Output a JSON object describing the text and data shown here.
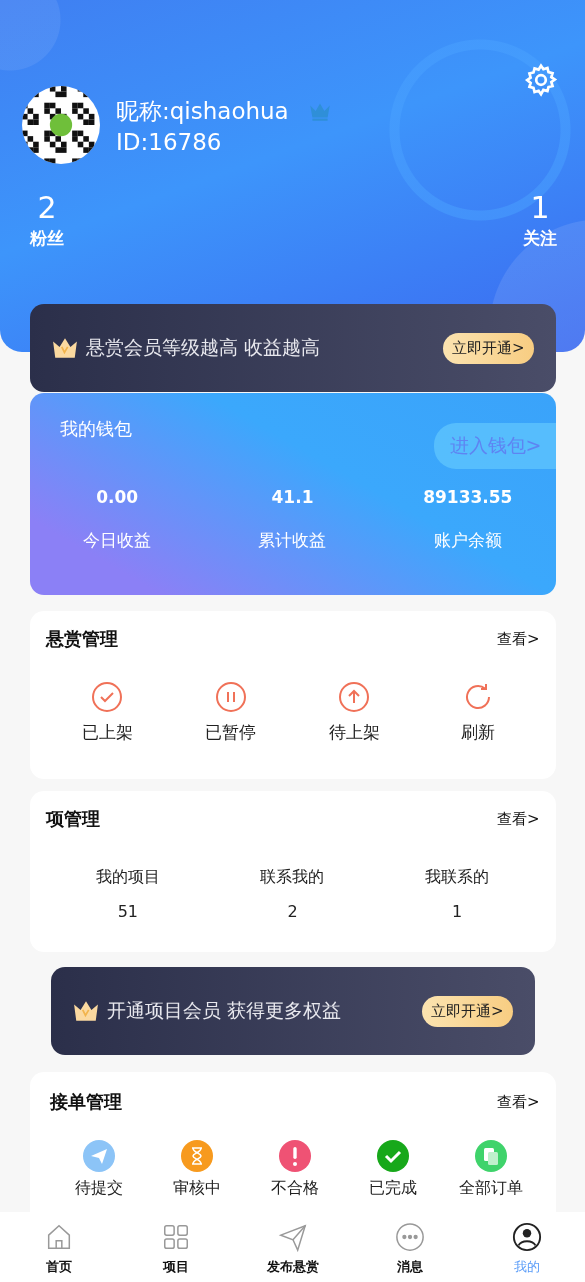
{
  "profile": {
    "nickname": "昵称:qishaohua",
    "id": "ID:16786",
    "stats": [
      {
        "value": "2",
        "label": "粉丝"
      },
      {
        "value": "1",
        "label": "关注"
      }
    ]
  },
  "member_banner": {
    "text": "悬赏会员等级越高 收益越高",
    "button": "立即开通>"
  },
  "wallet": {
    "title": "我的钱包",
    "enter": "进入钱包>",
    "items": [
      {
        "value": "0.00",
        "label": "今日收益"
      },
      {
        "value": "41.1",
        "label": "累计收益"
      },
      {
        "value": "89133.55",
        "label": "账户余额"
      }
    ]
  },
  "bounty": {
    "title": "悬赏管理",
    "more": "查看>",
    "items": [
      {
        "kind": "check",
        "label": "已上架"
      },
      {
        "kind": "pause",
        "label": "已暂停"
      },
      {
        "kind": "up",
        "label": "待上架"
      },
      {
        "kind": "refresh",
        "label": "刷新"
      }
    ]
  },
  "projects": {
    "title": "项管理",
    "more": "查看>",
    "items": [
      {
        "label": "我的项目",
        "value": "51"
      },
      {
        "label": "联系我的",
        "value": "2"
      },
      {
        "label": "我联系的",
        "value": "1"
      }
    ]
  },
  "project_banner": {
    "text": "开通项目会员 获得更多权益",
    "button": "立即开通>"
  },
  "orders": {
    "title": "接单管理",
    "more": "查看>",
    "items": [
      {
        "kind": "send",
        "label": "待提交",
        "color": "#8cc4f7"
      },
      {
        "kind": "hourglass",
        "label": "审核中",
        "color": "#f79a1e"
      },
      {
        "kind": "alert",
        "label": "不合格",
        "color": "#ef5274"
      },
      {
        "kind": "check",
        "label": "已完成",
        "color": "#17a81a"
      },
      {
        "kind": "copy",
        "label": "全部订单",
        "color": "#3fd36b"
      }
    ]
  },
  "tabbar": [
    {
      "kind": "home",
      "label": "首页",
      "selected": false
    },
    {
      "kind": "grid",
      "label": "项目",
      "selected": false
    },
    {
      "kind": "send",
      "label": "发布悬赏",
      "selected": false
    },
    {
      "kind": "chat",
      "label": "消息",
      "selected": false
    },
    {
      "kind": "user",
      "label": "我的",
      "selected": true
    }
  ]
}
